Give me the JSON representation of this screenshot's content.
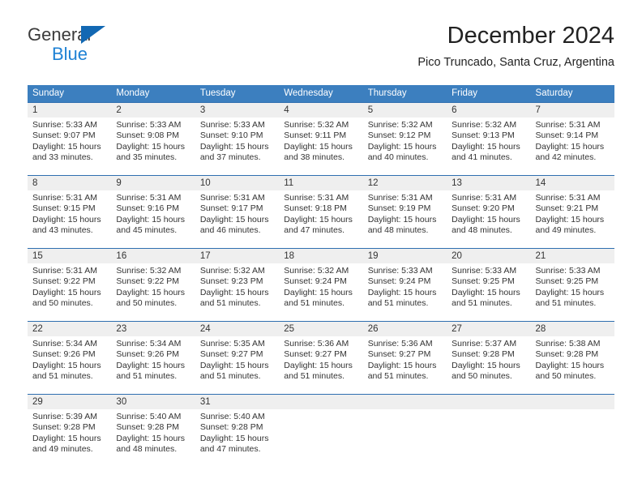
{
  "brand": {
    "name_part1": "General",
    "name_part2": "Blue",
    "triangle_color": "#1268b3",
    "blue_text_color": "#1e81d4"
  },
  "header": {
    "title": "December 2024",
    "subtitle": "Pico Truncado, Santa Cruz, Argentina"
  },
  "theme": {
    "header_row_bg": "#3c7fbf",
    "header_row_text": "#ffffff",
    "daynum_band_bg": "#efefef",
    "week_divider": "#2f6fb0",
    "body_text": "#333333"
  },
  "weekdays": [
    "Sunday",
    "Monday",
    "Tuesday",
    "Wednesday",
    "Thursday",
    "Friday",
    "Saturday"
  ],
  "labels": {
    "sunrise_prefix": "Sunrise:",
    "sunset_prefix": "Sunset:",
    "daylight_prefix": "Daylight:"
  },
  "weeks": [
    {
      "days": [
        {
          "num": "1",
          "sunrise": "Sunrise: 5:33 AM",
          "sunset": "Sunset: 9:07 PM",
          "daylight_l1": "Daylight: 15 hours",
          "daylight_l2": "and 33 minutes."
        },
        {
          "num": "2",
          "sunrise": "Sunrise: 5:33 AM",
          "sunset": "Sunset: 9:08 PM",
          "daylight_l1": "Daylight: 15 hours",
          "daylight_l2": "and 35 minutes."
        },
        {
          "num": "3",
          "sunrise": "Sunrise: 5:33 AM",
          "sunset": "Sunset: 9:10 PM",
          "daylight_l1": "Daylight: 15 hours",
          "daylight_l2": "and 37 minutes."
        },
        {
          "num": "4",
          "sunrise": "Sunrise: 5:32 AM",
          "sunset": "Sunset: 9:11 PM",
          "daylight_l1": "Daylight: 15 hours",
          "daylight_l2": "and 38 minutes."
        },
        {
          "num": "5",
          "sunrise": "Sunrise: 5:32 AM",
          "sunset": "Sunset: 9:12 PM",
          "daylight_l1": "Daylight: 15 hours",
          "daylight_l2": "and 40 minutes."
        },
        {
          "num": "6",
          "sunrise": "Sunrise: 5:32 AM",
          "sunset": "Sunset: 9:13 PM",
          "daylight_l1": "Daylight: 15 hours",
          "daylight_l2": "and 41 minutes."
        },
        {
          "num": "7",
          "sunrise": "Sunrise: 5:31 AM",
          "sunset": "Sunset: 9:14 PM",
          "daylight_l1": "Daylight: 15 hours",
          "daylight_l2": "and 42 minutes."
        }
      ]
    },
    {
      "days": [
        {
          "num": "8",
          "sunrise": "Sunrise: 5:31 AM",
          "sunset": "Sunset: 9:15 PM",
          "daylight_l1": "Daylight: 15 hours",
          "daylight_l2": "and 43 minutes."
        },
        {
          "num": "9",
          "sunrise": "Sunrise: 5:31 AM",
          "sunset": "Sunset: 9:16 PM",
          "daylight_l1": "Daylight: 15 hours",
          "daylight_l2": "and 45 minutes."
        },
        {
          "num": "10",
          "sunrise": "Sunrise: 5:31 AM",
          "sunset": "Sunset: 9:17 PM",
          "daylight_l1": "Daylight: 15 hours",
          "daylight_l2": "and 46 minutes."
        },
        {
          "num": "11",
          "sunrise": "Sunrise: 5:31 AM",
          "sunset": "Sunset: 9:18 PM",
          "daylight_l1": "Daylight: 15 hours",
          "daylight_l2": "and 47 minutes."
        },
        {
          "num": "12",
          "sunrise": "Sunrise: 5:31 AM",
          "sunset": "Sunset: 9:19 PM",
          "daylight_l1": "Daylight: 15 hours",
          "daylight_l2": "and 48 minutes."
        },
        {
          "num": "13",
          "sunrise": "Sunrise: 5:31 AM",
          "sunset": "Sunset: 9:20 PM",
          "daylight_l1": "Daylight: 15 hours",
          "daylight_l2": "and 48 minutes."
        },
        {
          "num": "14",
          "sunrise": "Sunrise: 5:31 AM",
          "sunset": "Sunset: 9:21 PM",
          "daylight_l1": "Daylight: 15 hours",
          "daylight_l2": "and 49 minutes."
        }
      ]
    },
    {
      "days": [
        {
          "num": "15",
          "sunrise": "Sunrise: 5:31 AM",
          "sunset": "Sunset: 9:22 PM",
          "daylight_l1": "Daylight: 15 hours",
          "daylight_l2": "and 50 minutes."
        },
        {
          "num": "16",
          "sunrise": "Sunrise: 5:32 AM",
          "sunset": "Sunset: 9:22 PM",
          "daylight_l1": "Daylight: 15 hours",
          "daylight_l2": "and 50 minutes."
        },
        {
          "num": "17",
          "sunrise": "Sunrise: 5:32 AM",
          "sunset": "Sunset: 9:23 PM",
          "daylight_l1": "Daylight: 15 hours",
          "daylight_l2": "and 51 minutes."
        },
        {
          "num": "18",
          "sunrise": "Sunrise: 5:32 AM",
          "sunset": "Sunset: 9:24 PM",
          "daylight_l1": "Daylight: 15 hours",
          "daylight_l2": "and 51 minutes."
        },
        {
          "num": "19",
          "sunrise": "Sunrise: 5:33 AM",
          "sunset": "Sunset: 9:24 PM",
          "daylight_l1": "Daylight: 15 hours",
          "daylight_l2": "and 51 minutes."
        },
        {
          "num": "20",
          "sunrise": "Sunrise: 5:33 AM",
          "sunset": "Sunset: 9:25 PM",
          "daylight_l1": "Daylight: 15 hours",
          "daylight_l2": "and 51 minutes."
        },
        {
          "num": "21",
          "sunrise": "Sunrise: 5:33 AM",
          "sunset": "Sunset: 9:25 PM",
          "daylight_l1": "Daylight: 15 hours",
          "daylight_l2": "and 51 minutes."
        }
      ]
    },
    {
      "days": [
        {
          "num": "22",
          "sunrise": "Sunrise: 5:34 AM",
          "sunset": "Sunset: 9:26 PM",
          "daylight_l1": "Daylight: 15 hours",
          "daylight_l2": "and 51 minutes."
        },
        {
          "num": "23",
          "sunrise": "Sunrise: 5:34 AM",
          "sunset": "Sunset: 9:26 PM",
          "daylight_l1": "Daylight: 15 hours",
          "daylight_l2": "and 51 minutes."
        },
        {
          "num": "24",
          "sunrise": "Sunrise: 5:35 AM",
          "sunset": "Sunset: 9:27 PM",
          "daylight_l1": "Daylight: 15 hours",
          "daylight_l2": "and 51 minutes."
        },
        {
          "num": "25",
          "sunrise": "Sunrise: 5:36 AM",
          "sunset": "Sunset: 9:27 PM",
          "daylight_l1": "Daylight: 15 hours",
          "daylight_l2": "and 51 minutes."
        },
        {
          "num": "26",
          "sunrise": "Sunrise: 5:36 AM",
          "sunset": "Sunset: 9:27 PM",
          "daylight_l1": "Daylight: 15 hours",
          "daylight_l2": "and 51 minutes."
        },
        {
          "num": "27",
          "sunrise": "Sunrise: 5:37 AM",
          "sunset": "Sunset: 9:28 PM",
          "daylight_l1": "Daylight: 15 hours",
          "daylight_l2": "and 50 minutes."
        },
        {
          "num": "28",
          "sunrise": "Sunrise: 5:38 AM",
          "sunset": "Sunset: 9:28 PM",
          "daylight_l1": "Daylight: 15 hours",
          "daylight_l2": "and 50 minutes."
        }
      ]
    },
    {
      "days": [
        {
          "num": "29",
          "sunrise": "Sunrise: 5:39 AM",
          "sunset": "Sunset: 9:28 PM",
          "daylight_l1": "Daylight: 15 hours",
          "daylight_l2": "and 49 minutes."
        },
        {
          "num": "30",
          "sunrise": "Sunrise: 5:40 AM",
          "sunset": "Sunset: 9:28 PM",
          "daylight_l1": "Daylight: 15 hours",
          "daylight_l2": "and 48 minutes."
        },
        {
          "num": "31",
          "sunrise": "Sunrise: 5:40 AM",
          "sunset": "Sunset: 9:28 PM",
          "daylight_l1": "Daylight: 15 hours",
          "daylight_l2": "and 47 minutes."
        },
        {
          "num": "",
          "sunrise": "",
          "sunset": "",
          "daylight_l1": "",
          "daylight_l2": ""
        },
        {
          "num": "",
          "sunrise": "",
          "sunset": "",
          "daylight_l1": "",
          "daylight_l2": ""
        },
        {
          "num": "",
          "sunrise": "",
          "sunset": "",
          "daylight_l1": "",
          "daylight_l2": ""
        },
        {
          "num": "",
          "sunrise": "",
          "sunset": "",
          "daylight_l1": "",
          "daylight_l2": ""
        }
      ]
    }
  ]
}
